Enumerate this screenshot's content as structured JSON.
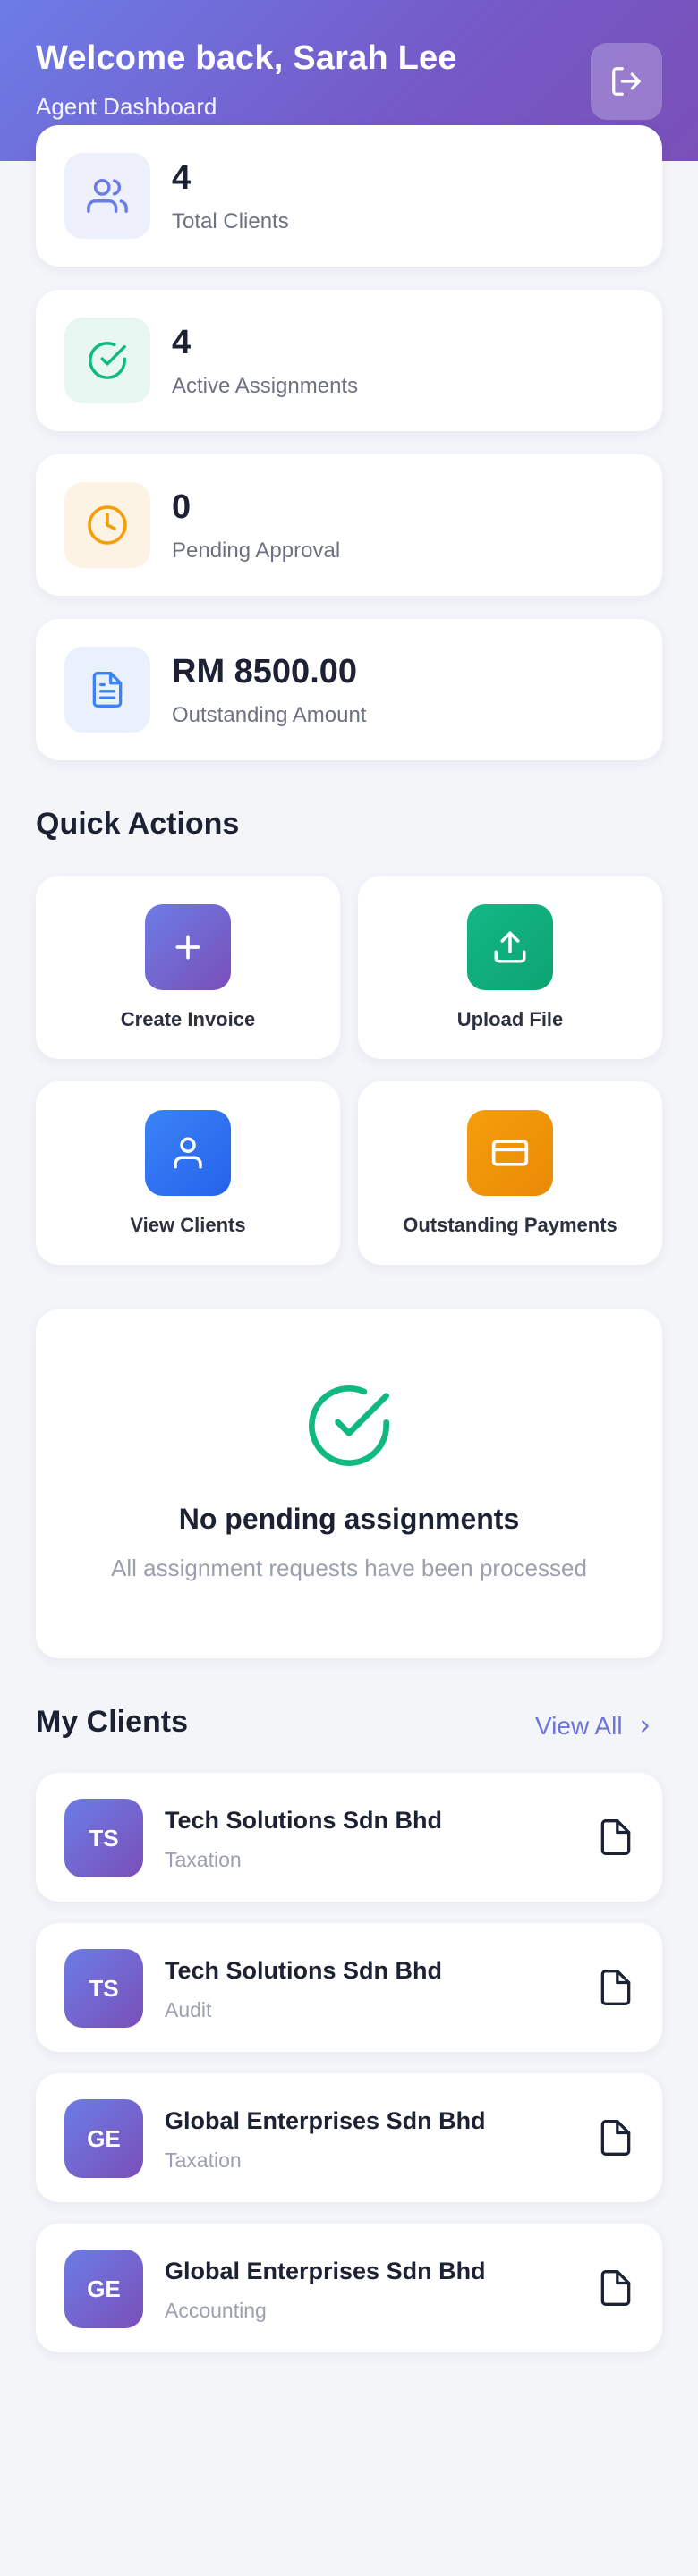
{
  "header": {
    "welcome": "Welcome back, Sarah Lee",
    "subtitle": "Agent Dashboard",
    "logout_icon": "logout-icon"
  },
  "stats": [
    {
      "value": "4",
      "label": "Total Clients",
      "icon": "users-icon",
      "color": "#6c7ce6"
    },
    {
      "value": "4",
      "label": "Active Assignments",
      "icon": "check-circle-icon",
      "color": "#10b981"
    },
    {
      "value": "0",
      "label": "Pending Approval",
      "icon": "clock-icon",
      "color": "#f59e0b"
    },
    {
      "value": "RM 8500.00",
      "label": "Outstanding Amount",
      "icon": "document-icon",
      "color": "#3b82f6"
    }
  ],
  "quick_actions": {
    "title": "Quick Actions",
    "items": [
      {
        "label": "Create Invoice",
        "icon": "plus-icon",
        "color": "#6c63d8"
      },
      {
        "label": "Upload File",
        "icon": "upload-icon",
        "color": "#10b981"
      },
      {
        "label": "View Clients",
        "icon": "user-icon",
        "color": "#3b82f6"
      },
      {
        "label": "Outstanding Payments",
        "icon": "credit-card-icon",
        "color": "#f59e0b"
      }
    ]
  },
  "empty_state": {
    "title": "No pending assignments",
    "description": "All assignment requests have been processed"
  },
  "my_clients": {
    "title": "My Clients",
    "view_all": "View All",
    "items": [
      {
        "initials": "TS",
        "name": "Tech Solutions Sdn Bhd",
        "service": "Taxation"
      },
      {
        "initials": "TS",
        "name": "Tech Solutions Sdn Bhd",
        "service": "Audit"
      },
      {
        "initials": "GE",
        "name": "Global Enterprises Sdn Bhd",
        "service": "Taxation"
      },
      {
        "initials": "GE",
        "name": "Global Enterprises Sdn Bhd",
        "service": "Accounting"
      }
    ]
  }
}
